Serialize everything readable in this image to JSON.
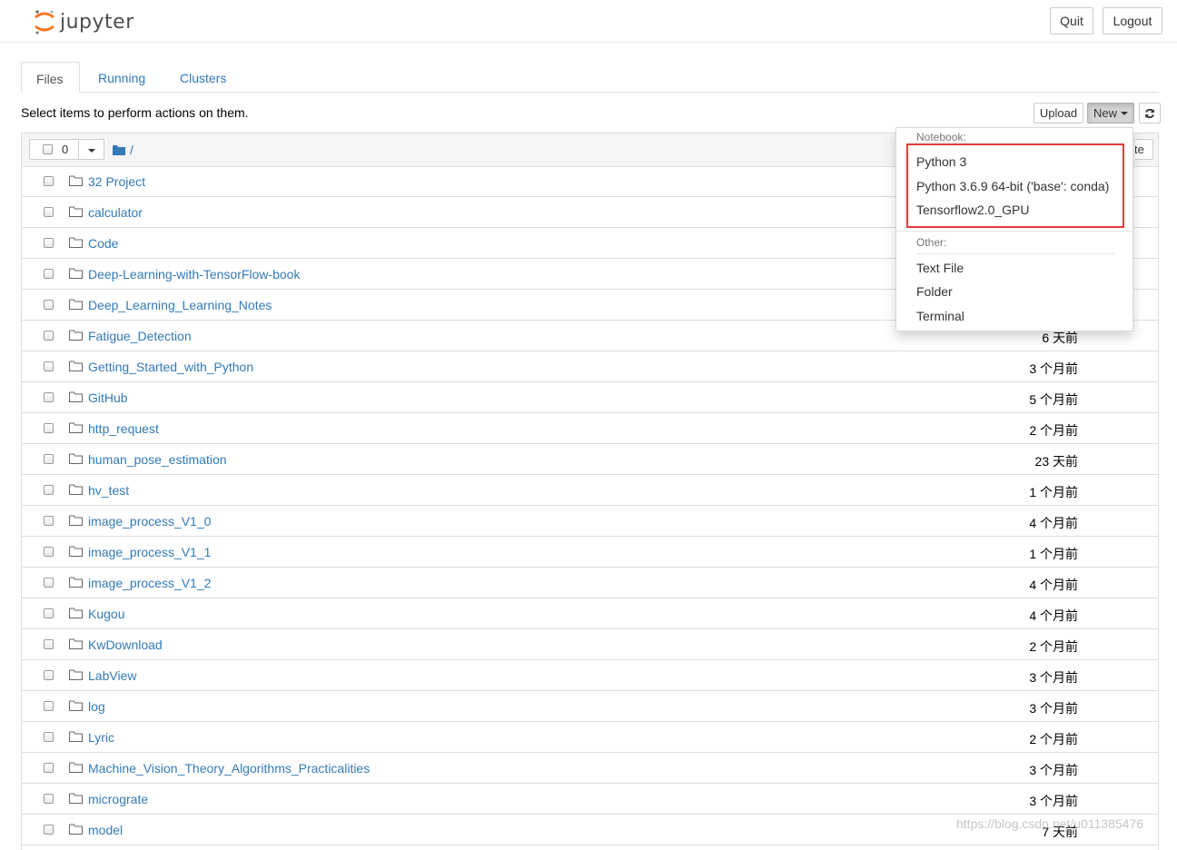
{
  "header": {
    "logo_text": "jupyter",
    "quit_label": "Quit",
    "logout_label": "Logout"
  },
  "tabs": [
    {
      "label": "Files",
      "active": true
    },
    {
      "label": "Running",
      "active": false
    },
    {
      "label": "Clusters",
      "active": false
    }
  ],
  "toolbar": {
    "select_info": "Select items to perform actions on them.",
    "upload_label": "Upload",
    "new_label": "New",
    "selected_count": "0",
    "breadcrumb_sep": "/",
    "sort_stub": "te"
  },
  "new_menu": {
    "notebook_header": "Notebook:",
    "notebook_items": [
      "Python 3",
      "Python 3.6.9 64-bit ('base': conda)",
      "Tensorflow2.0_GPU"
    ],
    "other_header": "Other:",
    "other_items": [
      "Text File",
      "Folder",
      "Terminal"
    ]
  },
  "files": [
    {
      "name": "32 Project",
      "time": ""
    },
    {
      "name": "calculator",
      "time": ""
    },
    {
      "name": "Code",
      "time": ""
    },
    {
      "name": "Deep-Learning-with-TensorFlow-book",
      "time": ""
    },
    {
      "name": "Deep_Learning_Learning_Notes",
      "time": ""
    },
    {
      "name": "Fatigue_Detection",
      "time": "6 天前"
    },
    {
      "name": "Getting_Started_with_Python",
      "time": "3 个月前"
    },
    {
      "name": "GitHub",
      "time": "5 个月前"
    },
    {
      "name": "http_request",
      "time": "2 个月前"
    },
    {
      "name": "human_pose_estimation",
      "time": "23 天前"
    },
    {
      "name": "hv_test",
      "time": "1 个月前"
    },
    {
      "name": "image_process_V1_0",
      "time": "4 个月前"
    },
    {
      "name": "image_process_V1_1",
      "time": "1 个月前"
    },
    {
      "name": "image_process_V1_2",
      "time": "4 个月前"
    },
    {
      "name": "Kugou",
      "time": "4 个月前"
    },
    {
      "name": "KwDownload",
      "time": "2 个月前"
    },
    {
      "name": "LabView",
      "time": "3 个月前"
    },
    {
      "name": "log",
      "time": "3 个月前"
    },
    {
      "name": "Lyric",
      "time": "2 个月前"
    },
    {
      "name": "Machine_Vision_Theory_Algorithms_Practicalities",
      "time": "3 个月前"
    },
    {
      "name": "micrograte",
      "time": "3 个月前"
    },
    {
      "name": "model",
      "time": "7 天前"
    }
  ],
  "watermark": "https://blog.csdn.net/u011385476",
  "colors": {
    "link": "#337ab7",
    "highlight": "#e53935"
  }
}
